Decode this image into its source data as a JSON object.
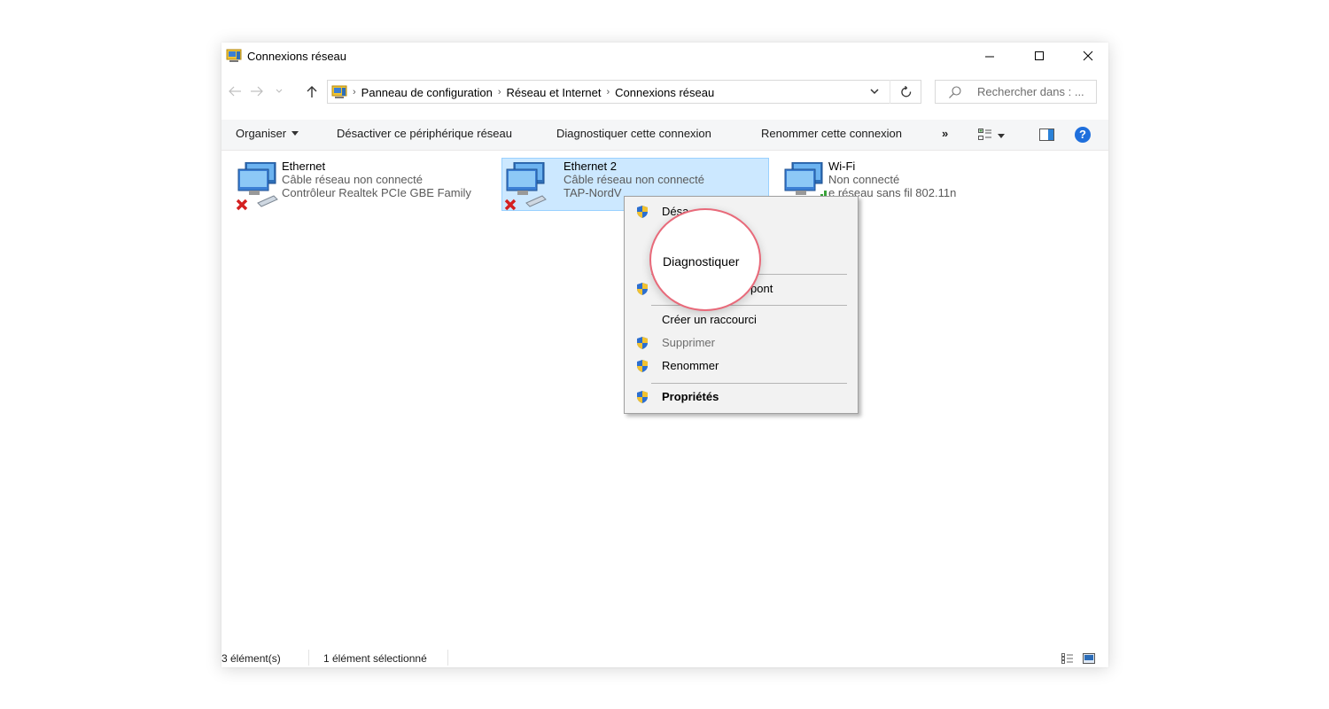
{
  "window": {
    "title": "Connexions réseau"
  },
  "address": {
    "crumbs": [
      "Panneau de configuration",
      "Réseau et Internet",
      "Connexions réseau"
    ]
  },
  "search": {
    "placeholder": "Rechercher dans : ..."
  },
  "toolbar": {
    "organize": "Organiser",
    "disable": "Désactiver ce périphérique réseau",
    "diagnose": "Diagnostiquer cette connexion",
    "rename": "Renommer cette connexion",
    "more": "»",
    "help": "?"
  },
  "items": [
    {
      "name": "Ethernet",
      "status": "Câble réseau non connecté",
      "device": "Contrôleur Realtek PCIe GBE Family"
    },
    {
      "name": "Ethernet 2",
      "status": "Câble réseau non connecté",
      "device": "TAP-NordV"
    },
    {
      "name": "Wi-Fi",
      "status": "Non connecté",
      "device": "e réseau sans fil 802.11n"
    }
  ],
  "context_menu": {
    "disable": "Désa",
    "bridge": "pont",
    "shortcut": "Créer un raccourci",
    "delete": "Supprimer",
    "rename": "Renommer",
    "properties": "Propriétés"
  },
  "highlight": {
    "label": "Diagnostiquer"
  },
  "status": {
    "count": "3 élément(s)",
    "selected": "1 élément sélectionné"
  },
  "colors": {
    "selection_bg": "#cce8ff",
    "selection_border": "#99d1ff",
    "highlight_ring": "#e86a7a",
    "help_blue": "#1f6fdc"
  }
}
